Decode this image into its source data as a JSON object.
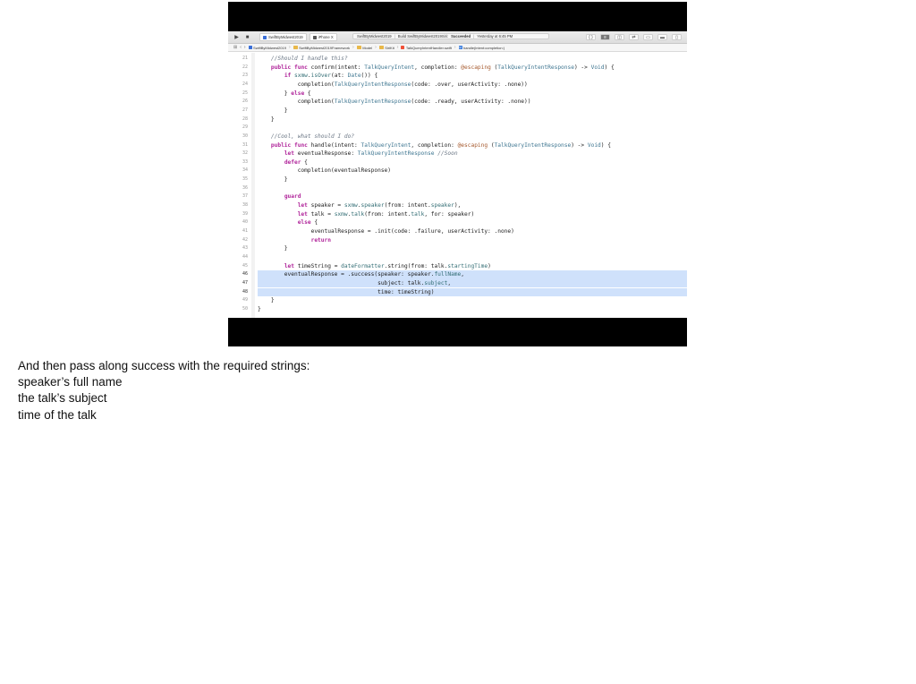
{
  "toolbar": {
    "scheme_name": "SwiftByMidwest2019",
    "device": "iPhone X",
    "status_project": "SwiftByMidwest2019",
    "status_build": "Build SwiftByMidwest2019Siri:",
    "status_result": "Succeeded",
    "status_time": "Yesterday at 6:45 PM"
  },
  "jumpbar": {
    "items": [
      "SwiftByMidwest2019",
      "SwiftByMidwest2019Framework",
      "Model",
      "SiriKit",
      "TalkQueryIntentHandler.swift",
      "handle(intent:completion:)"
    ]
  },
  "code": {
    "highlighted_lines": [
      "46",
      "47",
      "48"
    ],
    "lines": [
      {
        "num": "21",
        "text": "    //Should I handle this?"
      },
      {
        "num": "22",
        "text": "    public func confirm(intent: TalkQueryIntent, completion: @escaping (TalkQueryIntentResponse) -> Void) {"
      },
      {
        "num": "23",
        "text": "        if sxmw.isOver(at: Date()) {"
      },
      {
        "num": "24",
        "text": "            completion(TalkQueryIntentResponse(code: .over, userActivity: .none))"
      },
      {
        "num": "25",
        "text": "        } else {"
      },
      {
        "num": "26",
        "text": "            completion(TalkQueryIntentResponse(code: .ready, userActivity: .none))"
      },
      {
        "num": "27",
        "text": "        }"
      },
      {
        "num": "28",
        "text": "    }"
      },
      {
        "num": "29",
        "text": ""
      },
      {
        "num": "30",
        "text": "    //Cool, what should I do?"
      },
      {
        "num": "31",
        "text": "    public func handle(intent: TalkQueryIntent, completion: @escaping (TalkQueryIntentResponse) -> Void) {"
      },
      {
        "num": "32",
        "text": "        let eventualResponse: TalkQueryIntentResponse //Soon"
      },
      {
        "num": "33",
        "text": "        defer {"
      },
      {
        "num": "34",
        "text": "            completion(eventualResponse)"
      },
      {
        "num": "35",
        "text": "        }"
      },
      {
        "num": "36",
        "text": ""
      },
      {
        "num": "37",
        "text": "        guard"
      },
      {
        "num": "38",
        "text": "            let speaker = sxmw.speaker(from: intent.speaker),"
      },
      {
        "num": "39",
        "text": "            let talk = sxmw.talk(from: intent.talk, for: speaker)"
      },
      {
        "num": "40",
        "text": "            else {"
      },
      {
        "num": "41",
        "text": "                eventualResponse = .init(code: .failure, userActivity: .none)"
      },
      {
        "num": "42",
        "text": "                return"
      },
      {
        "num": "43",
        "text": "        }"
      },
      {
        "num": "44",
        "text": ""
      },
      {
        "num": "45",
        "text": "        let timeString = dateFormatter.string(from: talk.startingTime)"
      },
      {
        "num": "46",
        "text": "        eventualResponse = .success(speaker: speaker.fullName,"
      },
      {
        "num": "47",
        "text": "                                    subject: talk.subject,"
      },
      {
        "num": "48",
        "text": "                                    time: timeString)"
      },
      {
        "num": "49",
        "text": "    }"
      },
      {
        "num": "50",
        "text": "}"
      }
    ]
  },
  "caption": {
    "lines": [
      "And then pass along success with the required strings:",
      "speaker’s full name",
      "the talk’s subject",
      "time of the talk"
    ]
  }
}
